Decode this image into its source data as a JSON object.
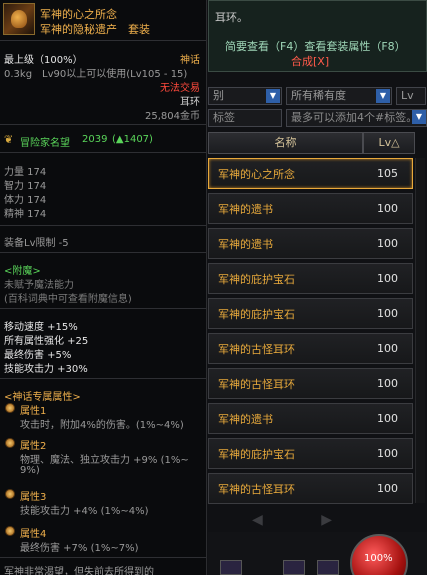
{
  "hint": {
    "title": "耳环。",
    "keys": "简要查看（F4）查看套装属性（F8）",
    "link": "合成[X]"
  },
  "filters": {
    "row1": [
      "别",
      "所有稀有度",
      "Lv"
    ],
    "tag_label": "标签",
    "tag_placeholder": "最多可以添加4个#标签。"
  },
  "table": {
    "col_name": "名称",
    "col_lv": "Lv△",
    "rows": [
      {
        "name": "军神的心之所念",
        "lv": "105"
      },
      {
        "name": "军神的遗书",
        "lv": "100"
      },
      {
        "name": "军神的遗书",
        "lv": "100"
      },
      {
        "name": "军神的庇护宝石",
        "lv": "100"
      },
      {
        "name": "军神的庇护宝石",
        "lv": "100"
      },
      {
        "name": "军神的古怪耳环",
        "lv": "100"
      },
      {
        "name": "军神的古怪耳环",
        "lv": "100"
      },
      {
        "name": "军神的遗书",
        "lv": "100"
      },
      {
        "name": "军神的庇护宝石",
        "lv": "100"
      },
      {
        "name": "军神的古怪耳环",
        "lv": "100"
      }
    ],
    "pager_prev": "◀",
    "pager_next": "▶"
  },
  "hud": {
    "hp": "100%"
  },
  "tooltip": {
    "name": "军神的心之所念",
    "set": "军神的隐秘遗产　套装",
    "grade": "最上级（100%）",
    "rarity": "神话",
    "weight_req": "0.3kg　Lv90以上可以使用(Lv105 - 15)",
    "trade": "无法交易",
    "slot": "耳环",
    "price": "25,804金币",
    "fame_label": "冒险家名望",
    "fame_value": "2039",
    "fame_delta": "(▲1407)",
    "stats": [
      "力量 174",
      "智力 174",
      "体力 174",
      "精神 174"
    ],
    "lv_limit": "装备Lv限制 -5",
    "enchant_title": "<附魔>",
    "enchant_lines": [
      "未赋予魔法能力",
      "(百科词典中可查看附魔信息)"
    ],
    "bonus": [
      "移动速度 +15%",
      "所有属性强化 +25",
      "最终伤害 +5%",
      "技能攻击力 +30%"
    ],
    "myth_title": "<神话专属属性>",
    "attrs": [
      {
        "name": "属性1",
        "lines": [
          "攻击时，附加4%的伤害。(1%~4%)"
        ]
      },
      {
        "name": "属性2",
        "lines": [
          "物理、魔法、独立攻击力 +9% (1%~",
          "9%)"
        ]
      },
      {
        "name": "属性3",
        "lines": [
          "技能攻击力 +4% (1%~4%)"
        ]
      },
      {
        "name": "属性4",
        "lines": [
          "最终伤害 +7% (1%~7%)"
        ]
      }
    ],
    "footer": "军神非常渴望，但失前去所得到的"
  }
}
